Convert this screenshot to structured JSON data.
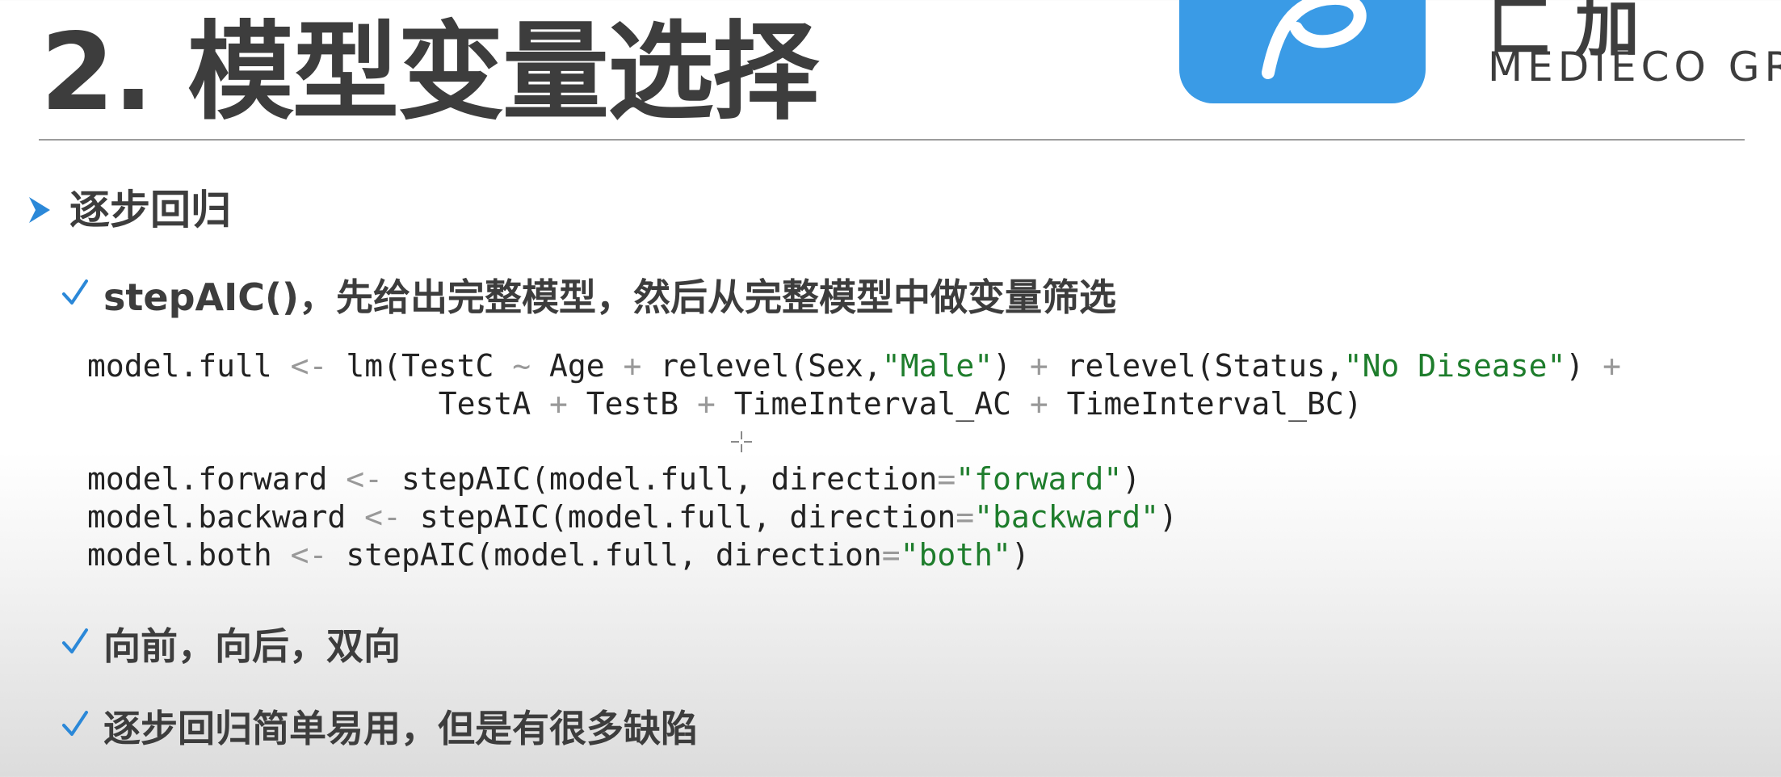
{
  "slide": {
    "title": "2. 模型变量选择",
    "brand_text": "MEDIECO GR",
    "brand_mark": "匚 加",
    "section_heading": "逐步回归",
    "bullets": [
      "stepAIC()，先给出完整模型，然后从完整模型中做变量筛选",
      "向前，向后，双向",
      "逐步回归简单易用，但是有很多缺陷"
    ],
    "code": {
      "line1": {
        "a": "model.full ",
        "arrow": "<-",
        "b": " lm(TestC ",
        "tilde": "~",
        "c": " Age ",
        "plus1": "+",
        "d": " relevel(Sex,",
        "s1": "\"Male\"",
        "e": ") ",
        "plus2": "+",
        "f": " relevel(Status,",
        "s2": "\"No Disease\"",
        "g": ") ",
        "plus3": "+"
      },
      "line2": {
        "indent": "                   ",
        "a": "TestA ",
        "plus1": "+",
        "b": " TestB ",
        "plus2": "+",
        "c": " TimeInterval_AC ",
        "plus3": "+",
        "d": " TimeInterval_BC)"
      },
      "line3": {
        "a": "model.forward ",
        "arrow": "<-",
        "b": " stepAIC(model.full, direction",
        "eq": "=",
        "s": "\"forward\"",
        "c": ")"
      },
      "line4": {
        "a": "model.backward ",
        "arrow": "<-",
        "b": " stepAIC(model.full, direction",
        "eq": "=",
        "s": "\"backward\"",
        "c": ")"
      },
      "line5": {
        "a": "model.both ",
        "arrow": "<-",
        "b": " stepAIC(model.full, direction",
        "eq": "=",
        "s": "\"both\"",
        "c": ")"
      }
    }
  },
  "icons": {
    "logo": "p-logo-icon",
    "section_marker": "arrow-bullet-icon",
    "bullet_marker": "checkmark-icon",
    "cursor": "crosshair-cursor-icon"
  },
  "colors": {
    "logo_blue": "#3a9be6",
    "accent_blue": "#2b88d8",
    "string_green": "#1e7d2c",
    "title_gray": "#3d3d3d"
  }
}
